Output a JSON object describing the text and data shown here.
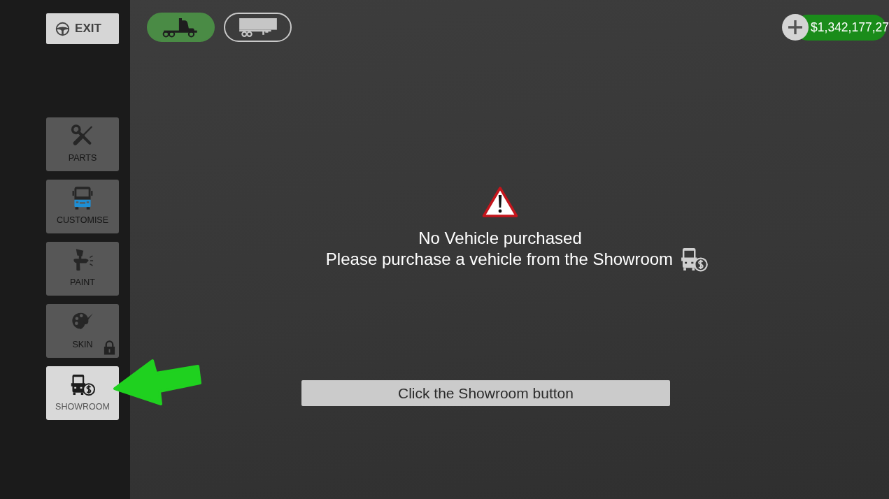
{
  "sidebar": {
    "exit_button": {
      "label": "EXIT"
    },
    "items": [
      {
        "kind": "parts",
        "label": "PARTS",
        "disabled": true,
        "locked": false
      },
      {
        "kind": "customise",
        "label": "CUSTOMISE",
        "disabled": true,
        "locked": false
      },
      {
        "kind": "paint",
        "label": "PAINT",
        "disabled": true,
        "locked": false
      },
      {
        "kind": "skin",
        "label": "SKIN",
        "disabled": true,
        "locked": true
      },
      {
        "kind": "showroom",
        "label": "SHOWROOM",
        "disabled": false,
        "locked": false
      }
    ]
  },
  "vehicle_tabs": [
    {
      "kind": "truck",
      "selected": true
    },
    {
      "kind": "trailer",
      "selected": false
    }
  ],
  "balance": {
    "amount": "$1,342,177,27"
  },
  "message": {
    "title": "No Vehicle purchased",
    "body": "Please purchase a vehicle from the Showroom"
  },
  "instruction": {
    "label": "Click the Showroom button"
  }
}
